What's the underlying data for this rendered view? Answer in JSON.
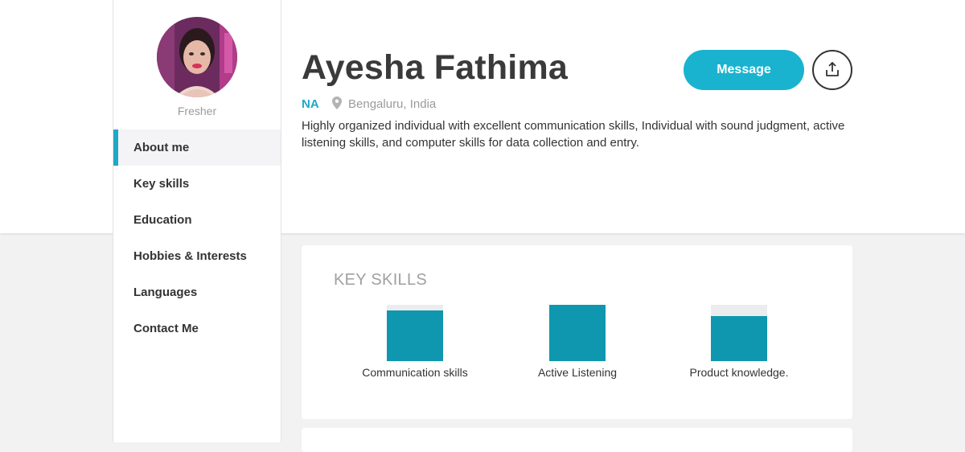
{
  "profile": {
    "name": "Ayesha Fathima",
    "status": "Fresher",
    "title_tag": "NA",
    "location": "Bengaluru, India",
    "bio": "Highly organized individual with excellent communication skills, Individual with sound judgment, active listening skills, and computer skills for data collection and entry."
  },
  "sidebar": {
    "items": [
      {
        "label": "About me",
        "active": true
      },
      {
        "label": "Key skills",
        "active": false
      },
      {
        "label": "Education",
        "active": false
      },
      {
        "label": "Hobbies & Interests",
        "active": false
      },
      {
        "label": "Languages",
        "active": false
      },
      {
        "label": "Contact Me",
        "active": false
      }
    ]
  },
  "actions": {
    "message_label": "Message",
    "share_icon": "share-upload-icon"
  },
  "key_skills": {
    "title": "KEY SKILLS",
    "skills": [
      {
        "name": "Communication skills",
        "level": 0.9
      },
      {
        "name": "Active Listening",
        "level": 1.0
      },
      {
        "name": "Product knowledge.",
        "level": 0.8
      }
    ]
  },
  "colors": {
    "accent": "#1ab3cf",
    "bar": "#0e97ae",
    "track": "#ececee"
  }
}
